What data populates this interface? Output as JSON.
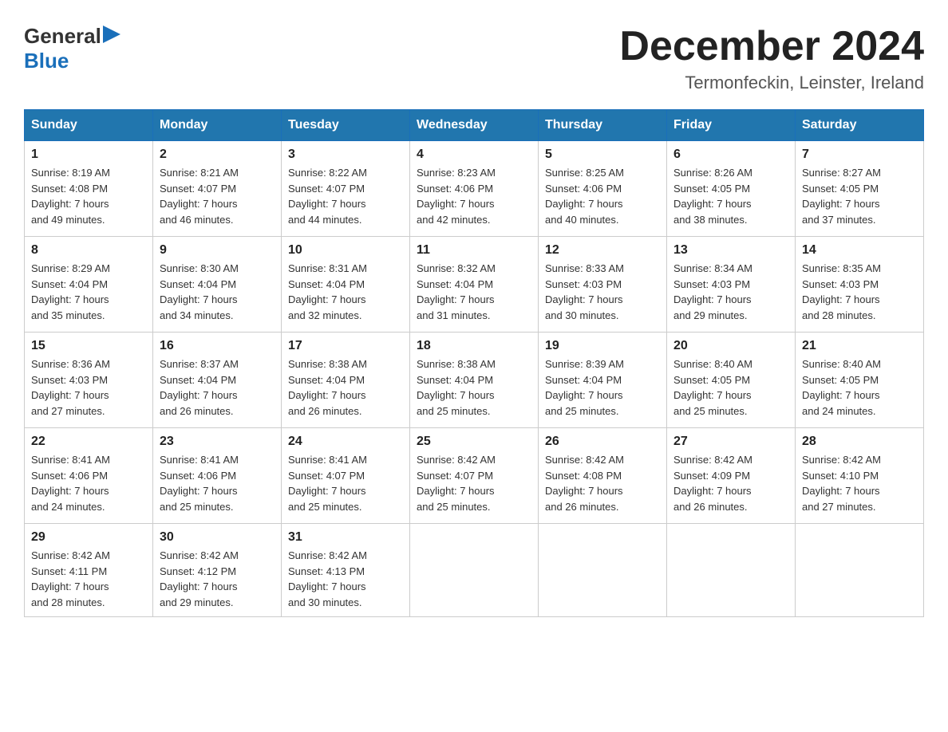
{
  "header": {
    "title": "December 2024",
    "location": "Termonfeckin, Leinster, Ireland",
    "logo": {
      "general": "General",
      "blue": "Blue"
    }
  },
  "days_of_week": [
    "Sunday",
    "Monday",
    "Tuesday",
    "Wednesday",
    "Thursday",
    "Friday",
    "Saturday"
  ],
  "weeks": [
    [
      {
        "day": "1",
        "sunrise": "Sunrise: 8:19 AM",
        "sunset": "Sunset: 4:08 PM",
        "daylight": "Daylight: 7 hours",
        "daylight2": "and 49 minutes."
      },
      {
        "day": "2",
        "sunrise": "Sunrise: 8:21 AM",
        "sunset": "Sunset: 4:07 PM",
        "daylight": "Daylight: 7 hours",
        "daylight2": "and 46 minutes."
      },
      {
        "day": "3",
        "sunrise": "Sunrise: 8:22 AM",
        "sunset": "Sunset: 4:07 PM",
        "daylight": "Daylight: 7 hours",
        "daylight2": "and 44 minutes."
      },
      {
        "day": "4",
        "sunrise": "Sunrise: 8:23 AM",
        "sunset": "Sunset: 4:06 PM",
        "daylight": "Daylight: 7 hours",
        "daylight2": "and 42 minutes."
      },
      {
        "day": "5",
        "sunrise": "Sunrise: 8:25 AM",
        "sunset": "Sunset: 4:06 PM",
        "daylight": "Daylight: 7 hours",
        "daylight2": "and 40 minutes."
      },
      {
        "day": "6",
        "sunrise": "Sunrise: 8:26 AM",
        "sunset": "Sunset: 4:05 PM",
        "daylight": "Daylight: 7 hours",
        "daylight2": "and 38 minutes."
      },
      {
        "day": "7",
        "sunrise": "Sunrise: 8:27 AM",
        "sunset": "Sunset: 4:05 PM",
        "daylight": "Daylight: 7 hours",
        "daylight2": "and 37 minutes."
      }
    ],
    [
      {
        "day": "8",
        "sunrise": "Sunrise: 8:29 AM",
        "sunset": "Sunset: 4:04 PM",
        "daylight": "Daylight: 7 hours",
        "daylight2": "and 35 minutes."
      },
      {
        "day": "9",
        "sunrise": "Sunrise: 8:30 AM",
        "sunset": "Sunset: 4:04 PM",
        "daylight": "Daylight: 7 hours",
        "daylight2": "and 34 minutes."
      },
      {
        "day": "10",
        "sunrise": "Sunrise: 8:31 AM",
        "sunset": "Sunset: 4:04 PM",
        "daylight": "Daylight: 7 hours",
        "daylight2": "and 32 minutes."
      },
      {
        "day": "11",
        "sunrise": "Sunrise: 8:32 AM",
        "sunset": "Sunset: 4:04 PM",
        "daylight": "Daylight: 7 hours",
        "daylight2": "and 31 minutes."
      },
      {
        "day": "12",
        "sunrise": "Sunrise: 8:33 AM",
        "sunset": "Sunset: 4:03 PM",
        "daylight": "Daylight: 7 hours",
        "daylight2": "and 30 minutes."
      },
      {
        "day": "13",
        "sunrise": "Sunrise: 8:34 AM",
        "sunset": "Sunset: 4:03 PM",
        "daylight": "Daylight: 7 hours",
        "daylight2": "and 29 minutes."
      },
      {
        "day": "14",
        "sunrise": "Sunrise: 8:35 AM",
        "sunset": "Sunset: 4:03 PM",
        "daylight": "Daylight: 7 hours",
        "daylight2": "and 28 minutes."
      }
    ],
    [
      {
        "day": "15",
        "sunrise": "Sunrise: 8:36 AM",
        "sunset": "Sunset: 4:03 PM",
        "daylight": "Daylight: 7 hours",
        "daylight2": "and 27 minutes."
      },
      {
        "day": "16",
        "sunrise": "Sunrise: 8:37 AM",
        "sunset": "Sunset: 4:04 PM",
        "daylight": "Daylight: 7 hours",
        "daylight2": "and 26 minutes."
      },
      {
        "day": "17",
        "sunrise": "Sunrise: 8:38 AM",
        "sunset": "Sunset: 4:04 PM",
        "daylight": "Daylight: 7 hours",
        "daylight2": "and 26 minutes."
      },
      {
        "day": "18",
        "sunrise": "Sunrise: 8:38 AM",
        "sunset": "Sunset: 4:04 PM",
        "daylight": "Daylight: 7 hours",
        "daylight2": "and 25 minutes."
      },
      {
        "day": "19",
        "sunrise": "Sunrise: 8:39 AM",
        "sunset": "Sunset: 4:04 PM",
        "daylight": "Daylight: 7 hours",
        "daylight2": "and 25 minutes."
      },
      {
        "day": "20",
        "sunrise": "Sunrise: 8:40 AM",
        "sunset": "Sunset: 4:05 PM",
        "daylight": "Daylight: 7 hours",
        "daylight2": "and 25 minutes."
      },
      {
        "day": "21",
        "sunrise": "Sunrise: 8:40 AM",
        "sunset": "Sunset: 4:05 PM",
        "daylight": "Daylight: 7 hours",
        "daylight2": "and 24 minutes."
      }
    ],
    [
      {
        "day": "22",
        "sunrise": "Sunrise: 8:41 AM",
        "sunset": "Sunset: 4:06 PM",
        "daylight": "Daylight: 7 hours",
        "daylight2": "and 24 minutes."
      },
      {
        "day": "23",
        "sunrise": "Sunrise: 8:41 AM",
        "sunset": "Sunset: 4:06 PM",
        "daylight": "Daylight: 7 hours",
        "daylight2": "and 25 minutes."
      },
      {
        "day": "24",
        "sunrise": "Sunrise: 8:41 AM",
        "sunset": "Sunset: 4:07 PM",
        "daylight": "Daylight: 7 hours",
        "daylight2": "and 25 minutes."
      },
      {
        "day": "25",
        "sunrise": "Sunrise: 8:42 AM",
        "sunset": "Sunset: 4:07 PM",
        "daylight": "Daylight: 7 hours",
        "daylight2": "and 25 minutes."
      },
      {
        "day": "26",
        "sunrise": "Sunrise: 8:42 AM",
        "sunset": "Sunset: 4:08 PM",
        "daylight": "Daylight: 7 hours",
        "daylight2": "and 26 minutes."
      },
      {
        "day": "27",
        "sunrise": "Sunrise: 8:42 AM",
        "sunset": "Sunset: 4:09 PM",
        "daylight": "Daylight: 7 hours",
        "daylight2": "and 26 minutes."
      },
      {
        "day": "28",
        "sunrise": "Sunrise: 8:42 AM",
        "sunset": "Sunset: 4:10 PM",
        "daylight": "Daylight: 7 hours",
        "daylight2": "and 27 minutes."
      }
    ],
    [
      {
        "day": "29",
        "sunrise": "Sunrise: 8:42 AM",
        "sunset": "Sunset: 4:11 PM",
        "daylight": "Daylight: 7 hours",
        "daylight2": "and 28 minutes."
      },
      {
        "day": "30",
        "sunrise": "Sunrise: 8:42 AM",
        "sunset": "Sunset: 4:12 PM",
        "daylight": "Daylight: 7 hours",
        "daylight2": "and 29 minutes."
      },
      {
        "day": "31",
        "sunrise": "Sunrise: 8:42 AM",
        "sunset": "Sunset: 4:13 PM",
        "daylight": "Daylight: 7 hours",
        "daylight2": "and 30 minutes."
      },
      null,
      null,
      null,
      null
    ]
  ]
}
